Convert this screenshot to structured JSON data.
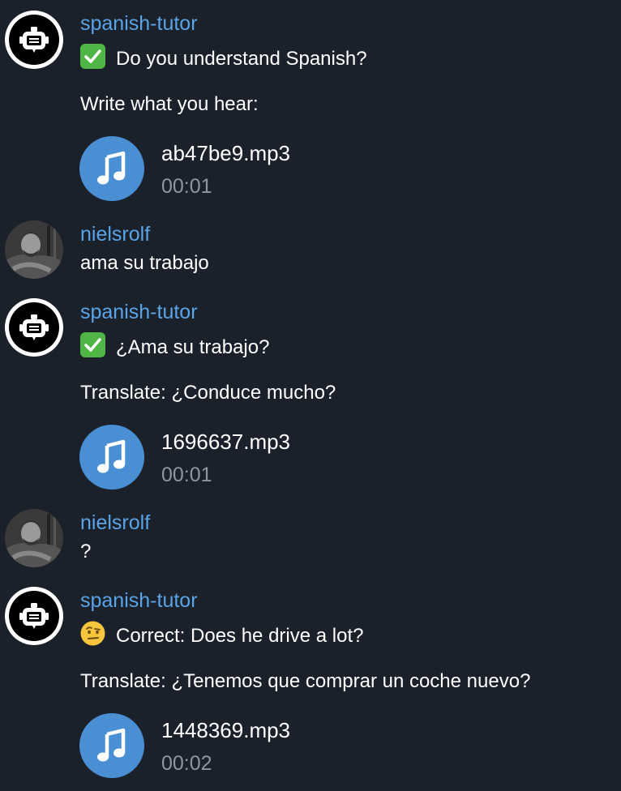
{
  "messages": [
    {
      "sender": "spanish-tutor",
      "status_icon": "check-mark-icon",
      "line1": "Do you understand Spanish?",
      "line2": "Write what you hear:",
      "audio": {
        "file": "ab47be9.mp3",
        "duration": "00:01"
      }
    },
    {
      "sender": "nielsrolf",
      "text": "ama su trabajo"
    },
    {
      "sender": "spanish-tutor",
      "status_icon": "check-mark-icon",
      "line1": "¿Ama su trabajo?",
      "line2": "Translate: ¿Conduce mucho?",
      "audio": {
        "file": "1696637.mp3",
        "duration": "00:01"
      }
    },
    {
      "sender": "nielsrolf",
      "text": "?"
    },
    {
      "sender": "spanish-tutor",
      "status_icon": "raised-eyebrow-face-icon",
      "line1": "Correct: Does he drive a lot?",
      "line2": "Translate: ¿Tenemos que comprar un coche nuevo?",
      "audio": {
        "file": "1448369.mp3",
        "duration": "00:02"
      }
    }
  ],
  "colors": {
    "background": "#1a212b",
    "sender_name": "#5aa4e8",
    "audio_button": "#4a8fd4",
    "duration_text": "#8d97a3"
  }
}
